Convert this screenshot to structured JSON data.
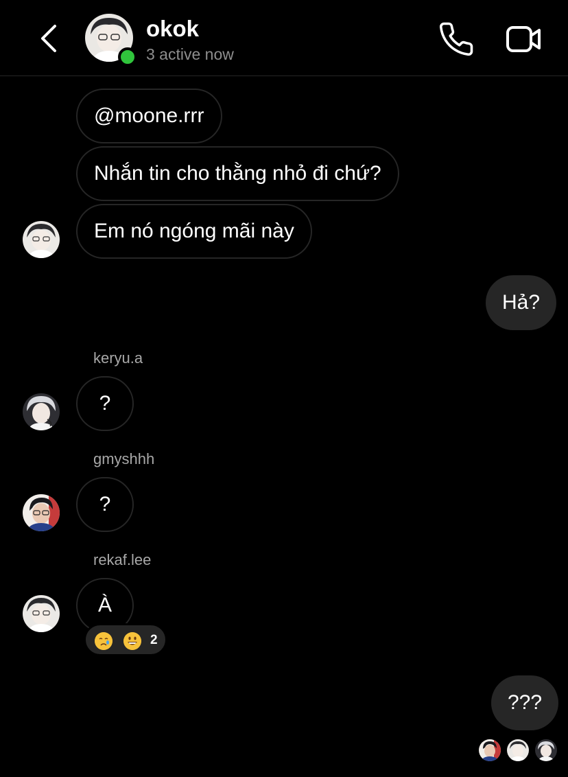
{
  "header": {
    "title": "okok",
    "status": "3 active now"
  },
  "messages": [
    {
      "direction": "incoming",
      "text": "@moone.rrr"
    },
    {
      "direction": "incoming",
      "text": "Nhắn tin cho thằng nhỏ đi chứ?"
    },
    {
      "direction": "incoming",
      "text": "Em nó ngóng mãi này"
    },
    {
      "direction": "outgoing",
      "text": "Hả?"
    },
    {
      "direction": "incoming",
      "sender": "keryu.a",
      "text": "?"
    },
    {
      "direction": "incoming",
      "sender": "gmyshhh",
      "text": "?"
    },
    {
      "direction": "incoming",
      "sender": "rekaf.lee",
      "text": "À",
      "reactions": {
        "emojis": [
          "crying-face",
          "grinning-face"
        ],
        "count": "2"
      }
    },
    {
      "direction": "outgoing",
      "text": "???"
    }
  ],
  "seen_by_count": 3,
  "colors": {
    "background": "#000000",
    "incoming_border": "#262626",
    "outgoing_bubble": "#262626",
    "active_indicator": "#30c53c",
    "secondary_text": "#8e8e8e"
  },
  "icons": {
    "back": "chevron-left-icon",
    "call": "phone-icon",
    "video": "video-camera-icon"
  }
}
